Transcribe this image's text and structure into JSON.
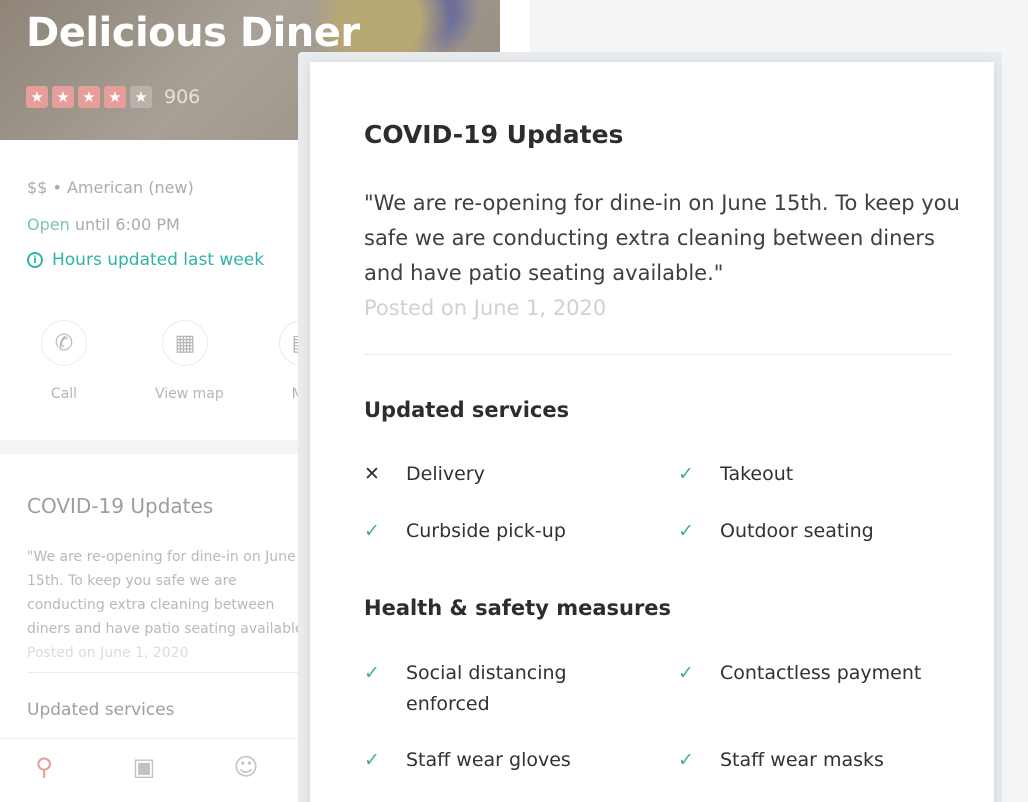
{
  "restaurant": {
    "name": "Delicious Diner",
    "rating_stars": 4,
    "rating_max": 5,
    "review_count": "906",
    "price_category": "$$ • American (new)",
    "open_word": "Open",
    "open_until": " until 6:00 PM",
    "hours_note": "Hours updated last week"
  },
  "actions": {
    "call": "Call",
    "view_map": "View map",
    "menu": "Me"
  },
  "background_covid": {
    "title": "COVID-19 Updates",
    "quote": "\"We are re-opening for dine-in on June 15th. To keep you safe we are conducting extra cleaning between diners and have patio seating available.\"",
    "posted": "Posted on June 1, 2020",
    "updated_services": "Updated services"
  },
  "covid_card": {
    "title": "COVID-19 Updates",
    "quote": "\"We are re-opening for dine-in on June 15th. To keep you safe we are conducting extra cleaning between diners and have patio seating available.\"",
    "posted": "Posted on June 1, 2020",
    "services_heading": "Updated services",
    "services": [
      {
        "label": "Delivery",
        "available": false
      },
      {
        "label": "Takeout",
        "available": true
      },
      {
        "label": "Curbside pick-up",
        "available": true
      },
      {
        "label": "Outdoor seating",
        "available": true
      }
    ],
    "health_heading": "Health & safety measures",
    "measures": [
      {
        "label": "Social distancing enforced",
        "available": true
      },
      {
        "label": "Contactless payment",
        "available": true
      },
      {
        "label": "Staff wear gloves",
        "available": true
      },
      {
        "label": "Staff wear masks",
        "available": true
      }
    ]
  },
  "icons": {
    "check": "✓",
    "cross": "✕",
    "star": "★",
    "info": "i",
    "call": "✆",
    "map": "▦",
    "menu": "▤",
    "search": "⚲",
    "bag": "▣",
    "profile": "☺"
  },
  "colors": {
    "check": "#43b28f",
    "accent_teal": "#2fb4a4",
    "star": "#e79e9a"
  }
}
